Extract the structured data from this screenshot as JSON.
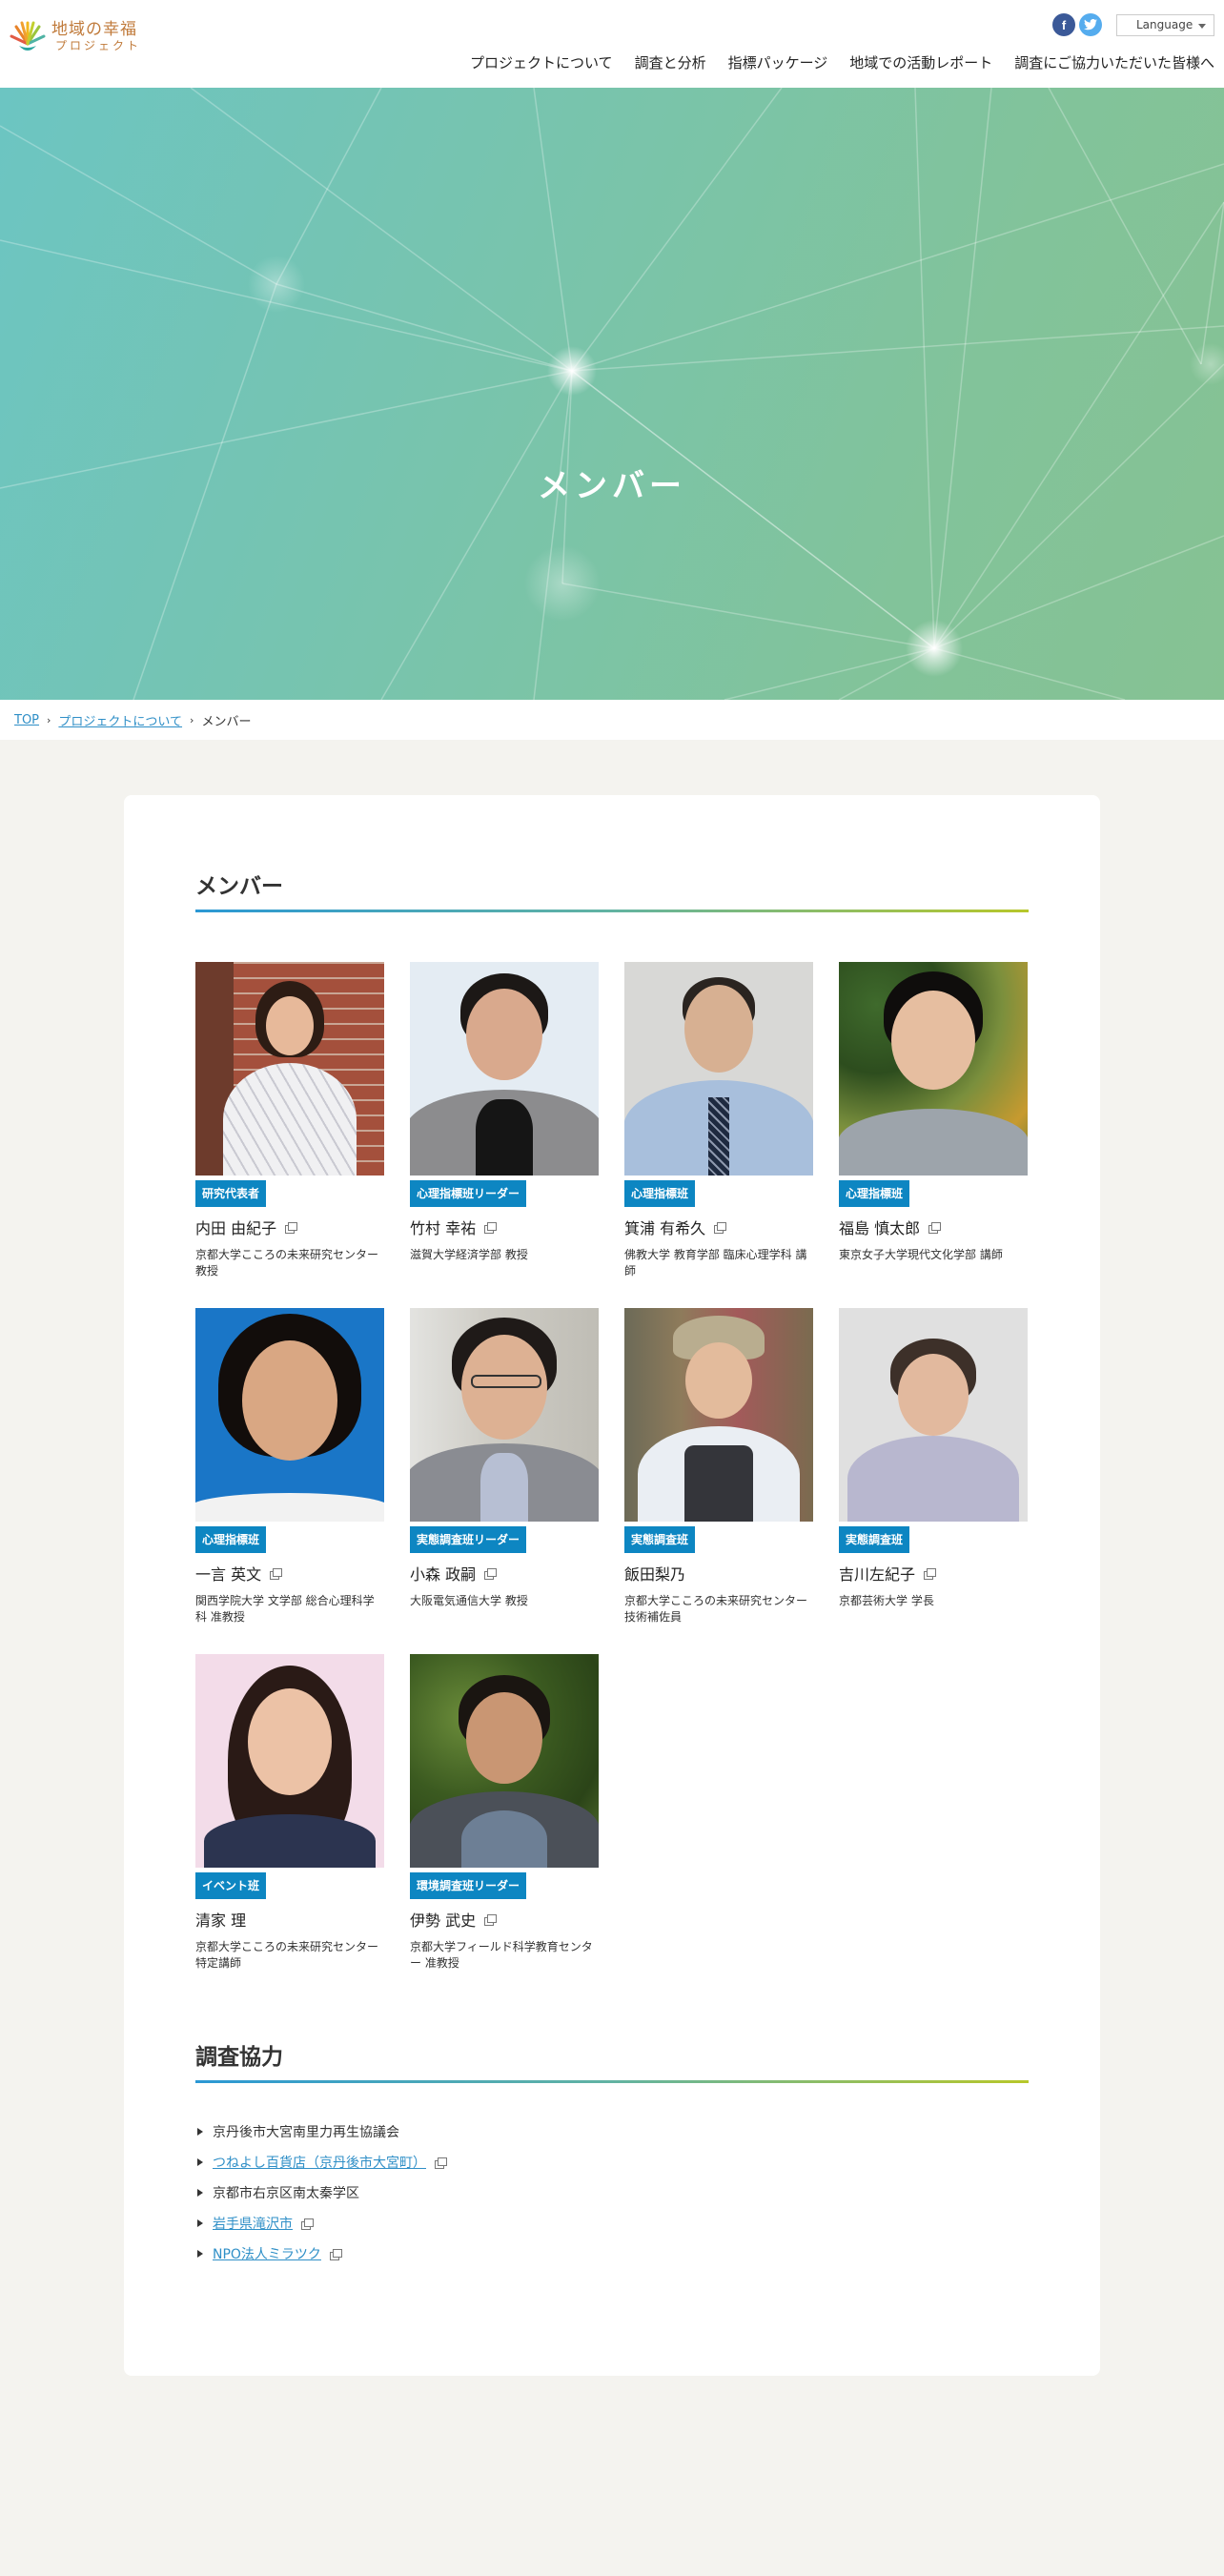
{
  "header": {
    "logo_line1": "地域の幸福",
    "logo_line2": "プロジェクト",
    "facebook_glyph": "f",
    "twitter_glyph": "t",
    "language_label": "Language",
    "nav": [
      "プロジェクトについて",
      "調査と分析",
      "指標パッケージ",
      "地域での活動レポート",
      "調査にご協力いただいた皆様へ"
    ]
  },
  "hero": {
    "title": "メンバー"
  },
  "breadcrumb": {
    "top": "TOP",
    "parent": "プロジェクトについて",
    "current": "メンバー",
    "sep": "›"
  },
  "members_section": {
    "title": "メンバー",
    "members": [
      {
        "role": "研究代表者",
        "name": "内田 由紀子",
        "affiliation": "京都大学こころの未来研究センター 教授",
        "link": true
      },
      {
        "role": "心理指標班リーダー",
        "name": "竹村 幸祐",
        "affiliation": "滋賀大学経済学部 教授",
        "link": true
      },
      {
        "role": "心理指標班",
        "name": "箕浦 有希久",
        "affiliation": "佛教大学 教育学部 臨床心理学科 講師",
        "link": true
      },
      {
        "role": "心理指標班",
        "name": "福島 慎太郎",
        "affiliation": "東京女子大学現代文化学部 講師",
        "link": true
      },
      {
        "role": "心理指標班",
        "name": "一言 英文",
        "affiliation": "関西学院大学 文学部 総合心理科学科 准教授",
        "link": true
      },
      {
        "role": "実態調査班リーダー",
        "name": "小森 政嗣",
        "affiliation": "大阪電気通信大学 教授",
        "link": true
      },
      {
        "role": "実態調査班",
        "name": "飯田梨乃",
        "affiliation": "京都大学こころの未来研究センター 技術補佐員",
        "link": false
      },
      {
        "role": "実態調査班",
        "name": "吉川左紀子",
        "affiliation": "京都芸術大学 学長",
        "link": true
      },
      {
        "role": "イベント班",
        "name": "清家 理",
        "affiliation": "京都大学こころの未来研究センター 特定講師",
        "link": false
      },
      {
        "role": "環境調査班リーダー",
        "name": "伊勢 武史",
        "affiliation": "京都大学フィールド科学教育センター 准教授",
        "link": true
      }
    ]
  },
  "coop_section": {
    "title": "調査協力",
    "items": [
      {
        "label": "京丹後市大宮南里力再生協議会",
        "link": false
      },
      {
        "label": "つねよし百貨店（京丹後市大宮町）",
        "link": true
      },
      {
        "label": "京都市右京区南太秦学区",
        "link": false
      },
      {
        "label": "岩手県滝沢市",
        "link": true
      },
      {
        "label": "NPO法人ミラツク",
        "link": true
      }
    ]
  },
  "colors": {
    "role_badge": "#0d86c2",
    "link": "#2f8fc7",
    "hero_start": "#6cc5c2",
    "hero_end": "#86c293"
  }
}
